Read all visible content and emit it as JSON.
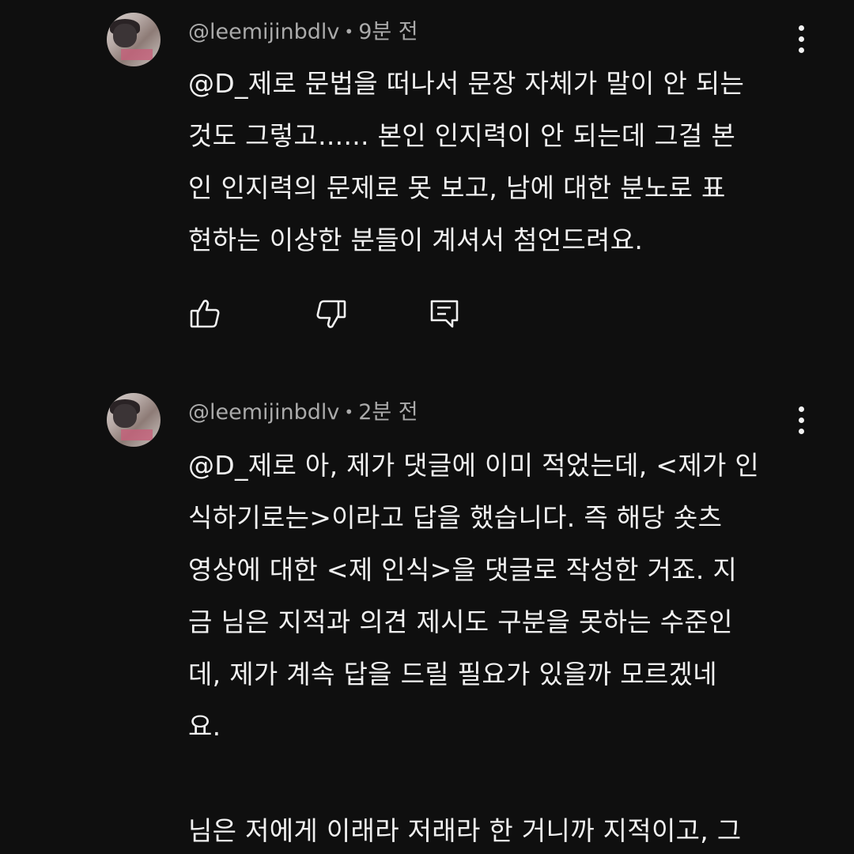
{
  "comments": [
    {
      "username": "@leemijinbdlv",
      "time": "9분 전",
      "text": "@D_제로 문법을 떠나서 문장 자체가 말이 안 되는\n것도 그렇고...... 본인 인지력이 안 되는데 그걸 본\n인 인지력의 문제로 못 보고, 남에 대한 분노로 표\n현하는 이상한 분들이 계셔서 첨언드려요.",
      "icons": [
        "like-icon",
        "dislike-icon",
        "reply-icon",
        "more-vert-icon"
      ]
    },
    {
      "username": "@leemijinbdlv",
      "time": "2분 전",
      "text": "@D_제로 아, 제가 댓글에 이미 적었는데, <제가 인\n식하기로는>이라고 답을 했습니다. 즉 해당 숏츠\n영상에 대한 <제 인식>을 댓글로 작성한 거죠. 지\n금 님은 지적과 의견 제시도 구분을 못하는 수준인\n데, 제가 계속 답을 드릴 필요가 있을까 모르겠네\n요.\n\n님은 저에게 이래라 저래라 한 거니까 지적이고, 그",
      "icons": [
        "more-vert-icon"
      ]
    }
  ],
  "colors": {
    "background": "#0f0f0f",
    "text": "#f1f1f1",
    "meta": "#aaaaaa"
  }
}
